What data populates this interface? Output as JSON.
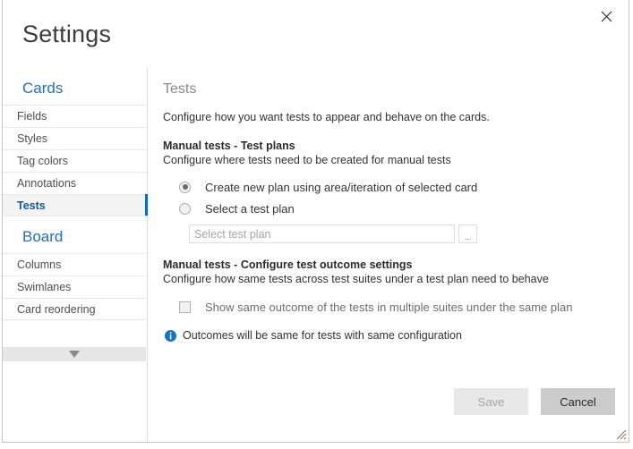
{
  "window": {
    "title": "Settings",
    "close_icon": "close-icon"
  },
  "sidebar": {
    "groups": [
      {
        "label": "Cards",
        "items": [
          {
            "label": "Fields",
            "selected": false
          },
          {
            "label": "Styles",
            "selected": false
          },
          {
            "label": "Tag colors",
            "selected": false
          },
          {
            "label": "Annotations",
            "selected": false
          },
          {
            "label": "Tests",
            "selected": true
          }
        ]
      },
      {
        "label": "Board",
        "items": [
          {
            "label": "Columns",
            "selected": false
          },
          {
            "label": "Swimlanes",
            "selected": false
          },
          {
            "label": "Card reordering",
            "selected": false
          }
        ]
      }
    ],
    "scroll_down_icon": "chevron-down-icon"
  },
  "content": {
    "title": "Tests",
    "description": "Configure how you want tests to appear and behave on the cards.",
    "section_test_plans": {
      "title": "Manual tests - Test plans",
      "subtitle": "Configure where tests need to be created for manual tests",
      "radio_create_new_plan": "Create new plan using area/iteration of selected card",
      "radio_select_test_plan": "Select a test plan",
      "test_plan_value": "",
      "test_plan_placeholder": "Select test plan",
      "browse_label": "..."
    },
    "section_outcome_settings": {
      "title": "Manual tests - Configure test outcome settings",
      "subtitle": "Configure how same tests across test suites under a test plan need to behave",
      "checkbox_label": "Show same outcome of the tests in multiple suites under the same plan",
      "info_icon": "info-icon",
      "info_text": "Outcomes will be same for tests with same configuration"
    }
  },
  "footer": {
    "save_label": "Save",
    "cancel_label": "Cancel"
  },
  "colors": {
    "accent_blue": "#1f6fc4",
    "selected_blue": "#0b6cbf",
    "info_blue": "#1074c8",
    "text": "#333333",
    "muted": "#8a8a8a"
  }
}
